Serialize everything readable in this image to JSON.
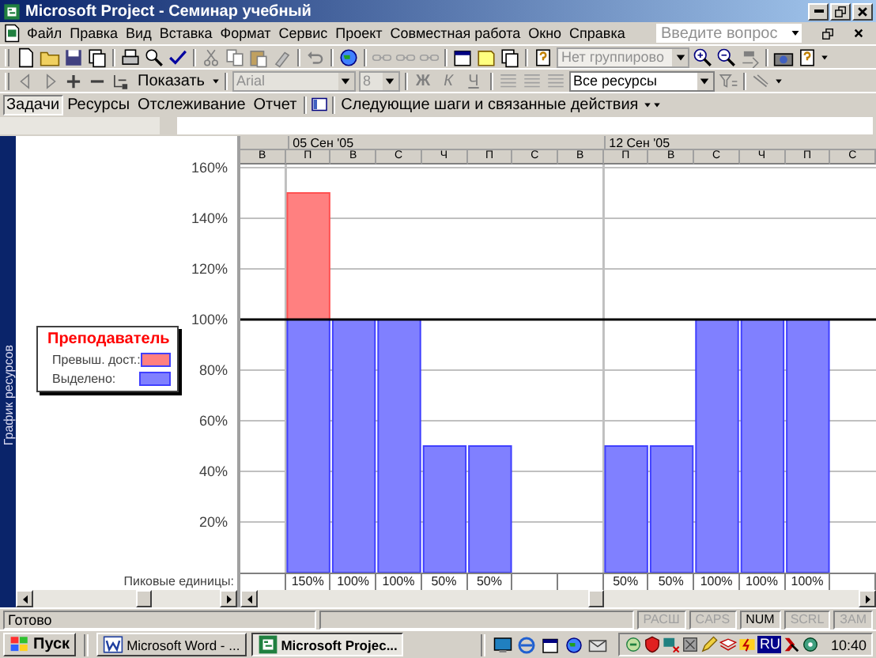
{
  "window": {
    "title": "Microsoft Project - Семинар учебный"
  },
  "menu": [
    "Файл",
    "Правка",
    "Вид",
    "Вставка",
    "Формат",
    "Сервис",
    "Проект",
    "Совместная работа",
    "Окно",
    "Справка"
  ],
  "help_search": {
    "placeholder": "Введите вопрос"
  },
  "standard_toolbar": {
    "group_by": {
      "value": "Нет группирово",
      "disabled": true
    }
  },
  "formatting_toolbar": {
    "show": "Показать",
    "font": {
      "value": "Arial",
      "disabled": true
    },
    "size": {
      "value": "8",
      "disabled": true
    },
    "style_buttons": [
      {
        "label": "Ж",
        "kind": "bold"
      },
      {
        "label": "К",
        "kind": "italic"
      },
      {
        "label": "Ч",
        "kind": "underline"
      }
    ],
    "filter": {
      "value": "Все ресурсы"
    }
  },
  "view_bar": {
    "tabs": [
      {
        "label": "Задачи",
        "selected": true
      },
      {
        "label": "Ресурсы",
        "selected": false
      },
      {
        "label": "Отслеживание",
        "selected": false
      },
      {
        "label": "Отчет",
        "selected": false
      }
    ],
    "guide": "Следующие шаги и связанные действия"
  },
  "view": {
    "side_label": "График ресурсов",
    "timescale": {
      "weeks": [
        "05 Сен '05",
        "12 Сен '05"
      ]
    },
    "peak_units": {
      "label": "Пиковые единицы:"
    },
    "chart_data": {
      "type": "bar",
      "title": "Преподаватель",
      "categories": [
        "В",
        "П",
        "В",
        "С",
        "Ч",
        "П",
        "С",
        "В",
        "П",
        "В",
        "С",
        "Ч",
        "П",
        "С"
      ],
      "stacked": true,
      "ylim": [
        0,
        160
      ],
      "yticks": [
        {
          "value": 20,
          "label": "20%"
        },
        {
          "value": 40,
          "label": "40%"
        },
        {
          "value": 60,
          "label": "60%"
        },
        {
          "value": 80,
          "label": "80%"
        },
        {
          "value": 100,
          "label": "100%"
        },
        {
          "value": 120,
          "label": "120%"
        },
        {
          "value": 140,
          "label": "140%"
        },
        {
          "value": 160,
          "label": "160%"
        }
      ],
      "series": [
        {
          "name": "Выделено:",
          "color": "#8080ff",
          "values": [
            null,
            100,
            100,
            100,
            50,
            50,
            null,
            null,
            50,
            50,
            100,
            100,
            100,
            null
          ]
        },
        {
          "name": "Превыш. дост.:",
          "color": "#ff8080",
          "values": [
            null,
            50,
            null,
            null,
            null,
            null,
            null,
            null,
            null,
            null,
            null,
            null,
            null,
            null
          ]
        }
      ],
      "grid": true,
      "legend": "left",
      "value_labels": [
        null,
        "150%",
        "100%",
        "100%",
        "50%",
        "50%",
        null,
        null,
        "50%",
        "50%",
        "100%",
        "100%",
        "100%",
        null
      ],
      "ref_lines": [
        {
          "axis": "y",
          "value": 100
        }
      ]
    }
  },
  "status_bar": {
    "text": "Готово",
    "indicators": [
      {
        "label": "РАСШ",
        "on": false
      },
      {
        "label": "CAPS",
        "on": false
      },
      {
        "label": "NUM",
        "on": true
      },
      {
        "label": "SCRL",
        "on": false
      },
      {
        "label": "ЗАМ",
        "on": false
      }
    ]
  },
  "taskbar": {
    "start": "Пуск",
    "tasks": [
      {
        "label": "Microsoft Word - ...",
        "selected": false
      },
      {
        "label": "Microsoft Projec...",
        "selected": true
      }
    ],
    "language": "RU",
    "time": "10:40"
  }
}
